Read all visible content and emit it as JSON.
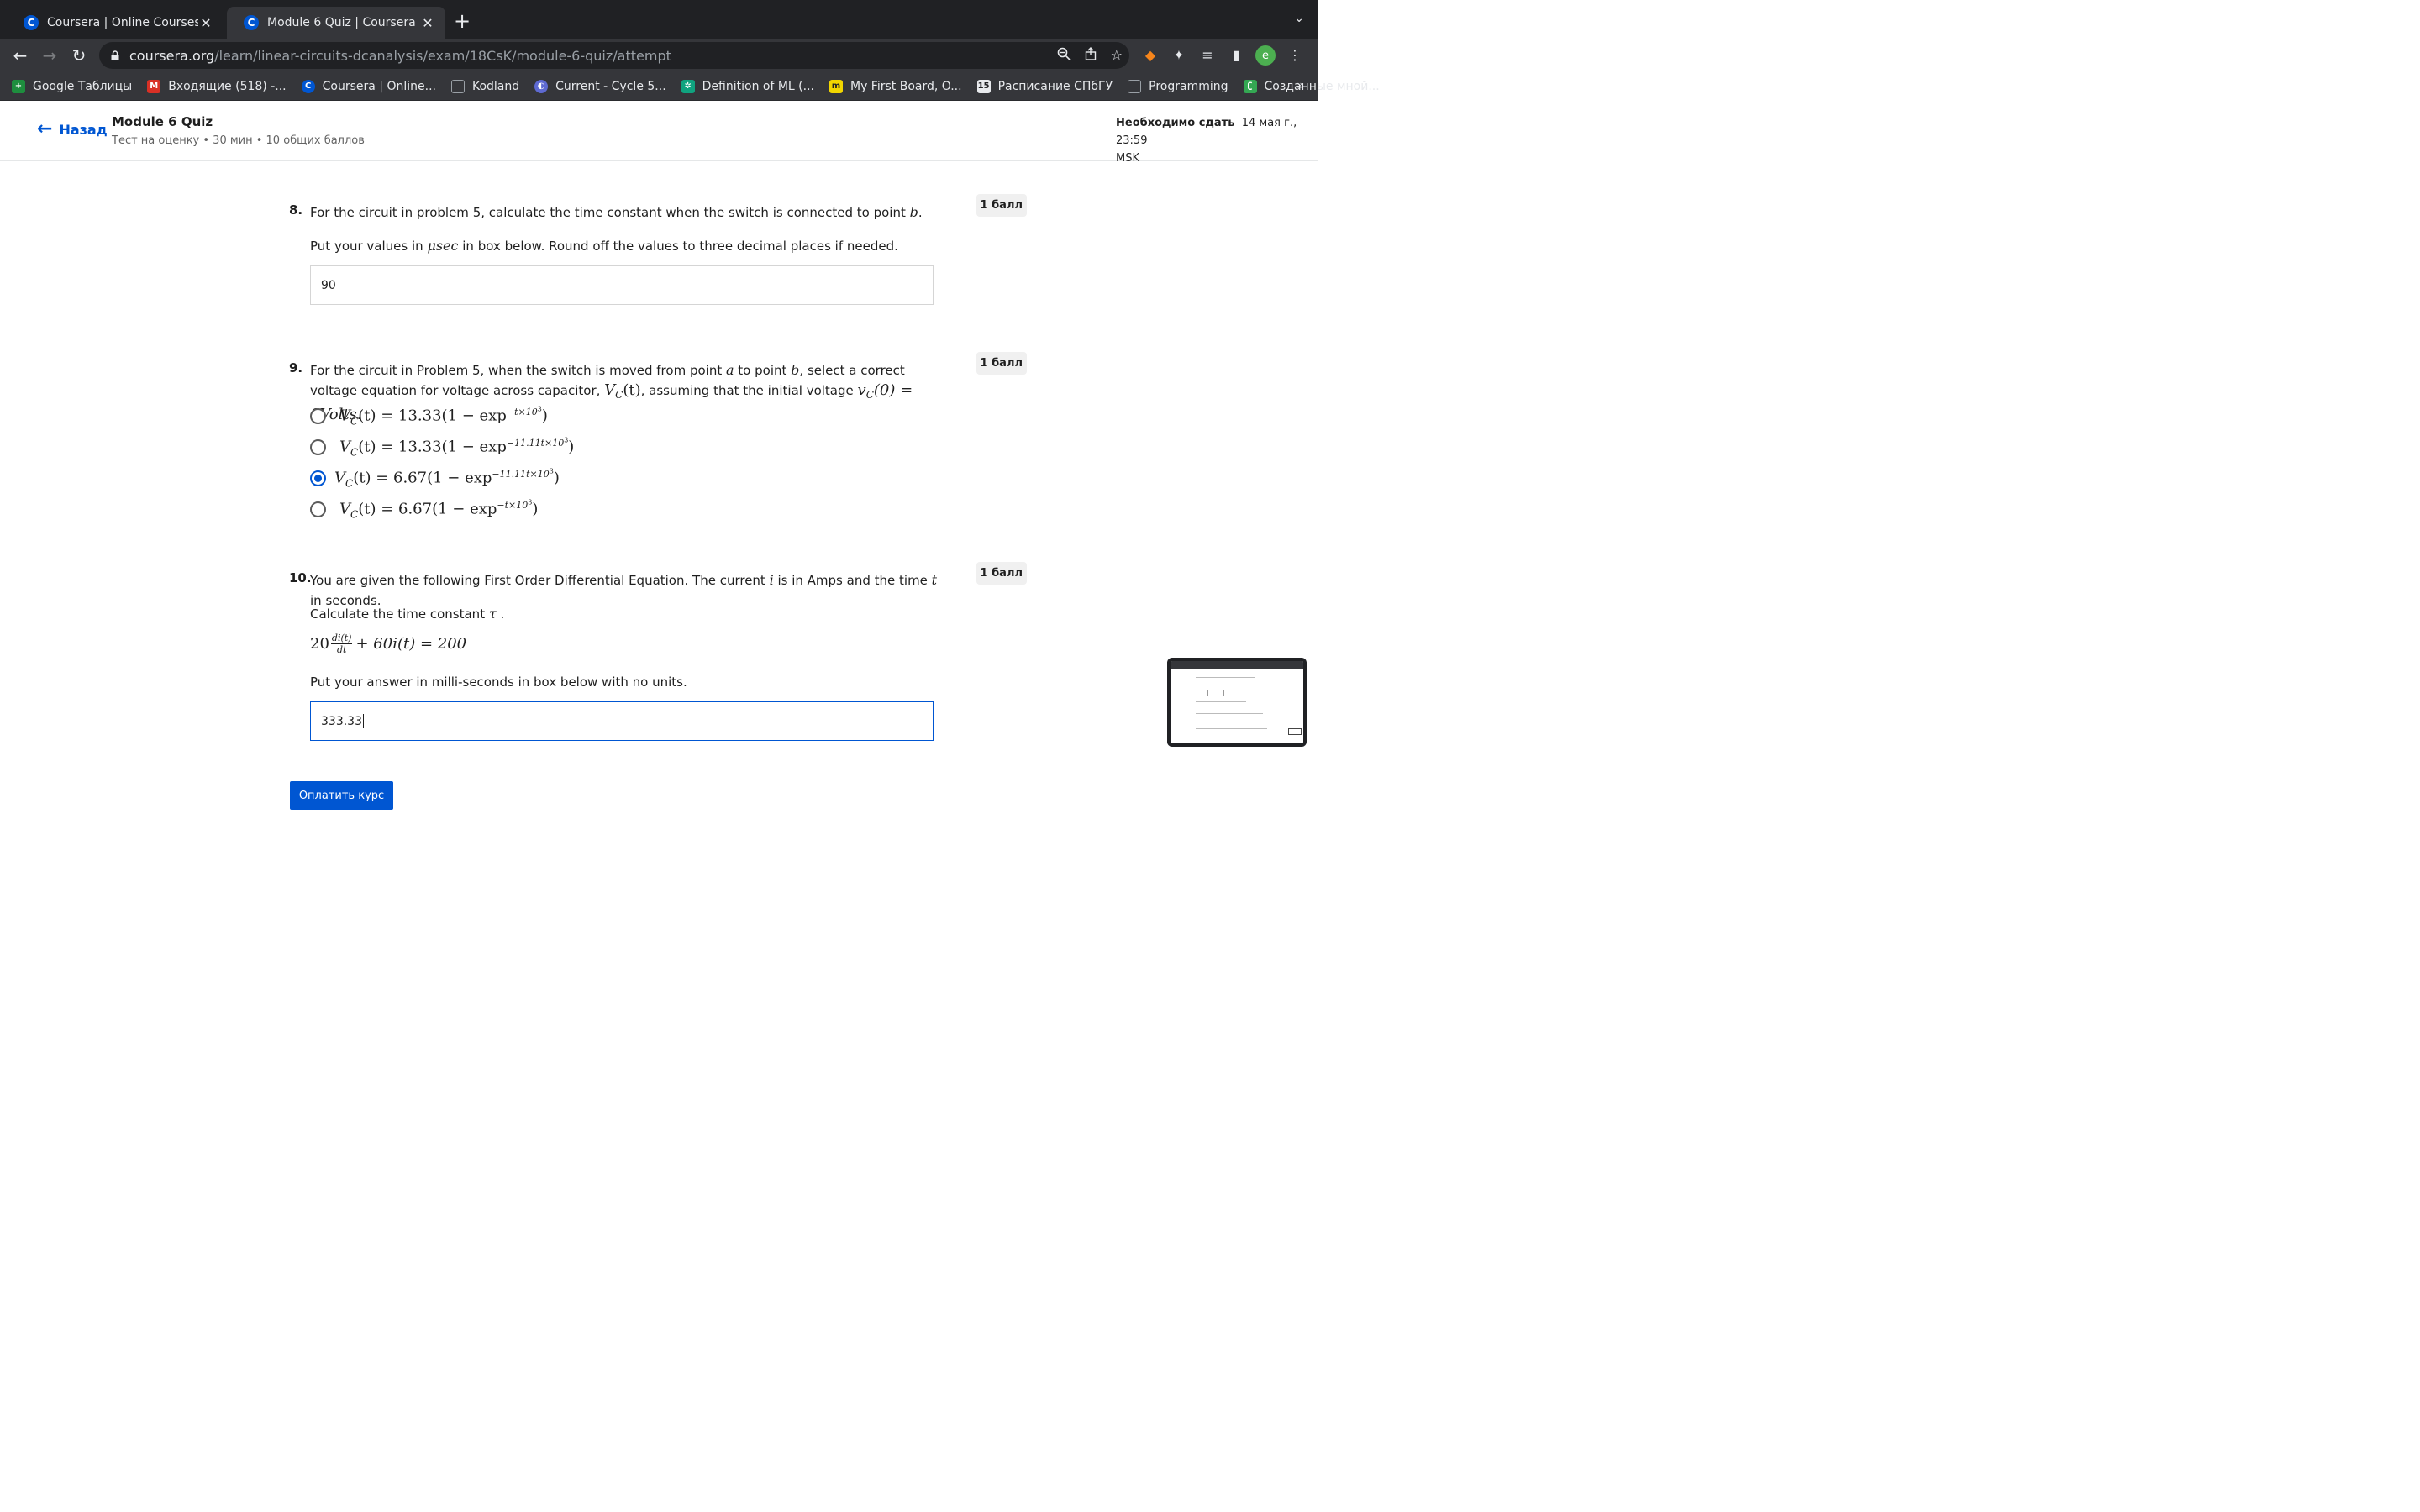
{
  "browser": {
    "tabs": [
      {
        "title": "Coursera | Online Courses & Cre",
        "favicon": "C",
        "active": false
      },
      {
        "title": "Module 6 Quiz | Coursera",
        "favicon": "C",
        "active": true
      }
    ],
    "url_domain": "coursera.org",
    "url_path": "/learn/linear-circuits-dcanalysis/exam/18CsK/module-6-quiz/attempt",
    "profile_initial": "e",
    "bookmarks": [
      {
        "label": "Google Таблицы",
        "icon": "sheets-icon",
        "color": "#1e8e3e"
      },
      {
        "label": "Входящие (518) -...",
        "icon": "gmail-icon",
        "color": "#d93025"
      },
      {
        "label": "Coursera | Online...",
        "icon": "coursera-icon",
        "color": "#0056d2"
      },
      {
        "label": "Kodland",
        "icon": "folder-icon",
        "color": "#9aa0a6"
      },
      {
        "label": "Current - Cycle 5...",
        "icon": "linear-icon",
        "color": "#5e6ad2"
      },
      {
        "label": "Definition of ML (...",
        "icon": "openai-icon",
        "color": "#10a37f"
      },
      {
        "label": "My First Board, O...",
        "icon": "miro-icon",
        "color": "#f2d600"
      },
      {
        "label": "Расписание СПбГУ",
        "icon": "calendar-icon",
        "color": "#e8eaed"
      },
      {
        "label": "Programming",
        "icon": "folder-icon",
        "color": "#9aa0a6"
      },
      {
        "label": "Созданные мной...",
        "icon": "leaf-icon",
        "color": "#34a853"
      }
    ],
    "bookmarks_more": "»"
  },
  "header": {
    "back_label": "Назад",
    "title": "Module 6 Quiz",
    "subtitle": "Тест на оценку • 30 мин • 10 общих баллов",
    "due_label": "Необходимо сдать",
    "due_date": "14 мая г., 23:59",
    "due_tz": "MSK"
  },
  "questions": {
    "q8": {
      "number": "8.",
      "text_a": "For the circuit in problem 5, calculate the time constant when the switch is connected to point ",
      "var_b": "b",
      "text_b": ".",
      "text2_a": "Put your values in ",
      "unit": "μsec",
      "text2_b": " in box below. Round off the values to three decimal places if needed.",
      "points": "1 балл",
      "answer": "90"
    },
    "q9": {
      "number": "9.",
      "text_a": "For the circuit in Problem 5, when the switch is moved from point ",
      "var_a": "a",
      "text_b": " to point ",
      "var_b": "b",
      "text_c": ", select a correct voltage equation for voltage across capacitor, ",
      "vc": "V",
      "vc_sub": "C",
      "vc_arg": "(t)",
      "text_d": ", assuming that the initial voltage ",
      "v0": "v",
      "v0_sub": "C",
      "v0_arg": "(0) = 0Volts",
      "text_e": ".",
      "points": "1 балл",
      "options": [
        {
          "lhs": "V",
          "sub": "C",
          "rhs": "(t) = 13.33(1 − exp",
          "exp": "−t×10",
          "exp3": "3",
          "close": ")",
          "selected": false
        },
        {
          "lhs": "V",
          "sub": "C",
          "rhs": "(t) = 13.33(1 − exp",
          "exp": "−11.11t×10",
          "exp3": "3",
          "close": ")",
          "selected": false
        },
        {
          "lhs": "V",
          "sub": "C",
          "rhs": "(t) = 6.67(1 − exp",
          "exp": "−11.11t×10",
          "exp3": "3",
          "close": ")",
          "selected": true
        },
        {
          "lhs": "V",
          "sub": "C",
          "rhs": "(t) = 6.67(1 − exp",
          "exp": "−t×10",
          "exp3": "3",
          "close": ")",
          "selected": false
        }
      ]
    },
    "q10": {
      "number": "10.",
      "text_a": "You are given the following First Order Differential Equation. The current ",
      "var_i": "i",
      "text_b": " is in Amps and the time ",
      "var_t": "t",
      "text_c": " in seconds.",
      "line2_a": "Calculate the time constant ",
      "tau": "τ",
      "line2_b": " .",
      "eq_coef": "20",
      "eq_num": "di(t)",
      "eq_den": "dt",
      "eq_rest": "+ 60i(t) = 200",
      "line3": "Put your answer in milli-seconds in box below with no units.",
      "points": "1 балл",
      "answer": "333.33"
    }
  },
  "pay_button": "Оплатить курс",
  "colors": {
    "accent": "#0056d2",
    "chrome_dark": "#202124",
    "chrome": "#35363a"
  }
}
